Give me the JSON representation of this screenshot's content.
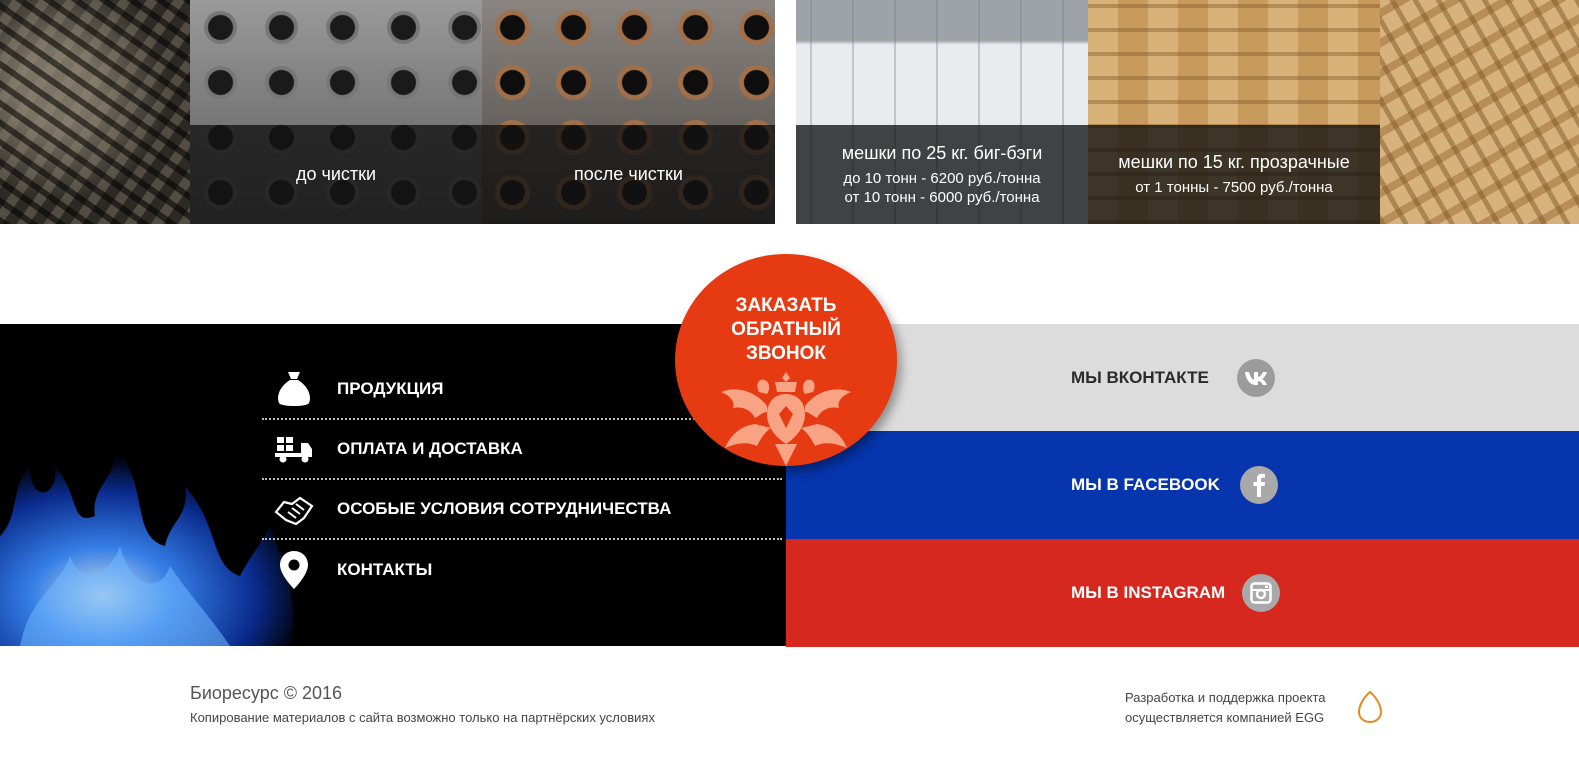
{
  "top_strip": {
    "tiles": [
      {
        "caption": ""
      },
      {
        "caption": "до чистки"
      },
      {
        "caption": "после чистки"
      },
      {
        "caption": "мешки по 25 кг. биг-бэги",
        "lines": [
          "до 10 тонн - 6200 руб./тонна",
          "от 10 тонн - 6000 руб./тонна"
        ]
      },
      {
        "caption": "мешки по 15 кг. прозрачные",
        "lines": [
          "от 1 тонны - 7500 руб./тонна"
        ]
      },
      {
        "caption": ""
      }
    ]
  },
  "callback": {
    "line1": "ЗАКАЗАТЬ",
    "line2": "ОБРАТНЫЙ",
    "line3": "ЗВОНОК",
    "color": "#e63a12"
  },
  "menu": {
    "items": [
      {
        "label": "ПРОДУКЦИЯ",
        "icon": "money-bag-icon"
      },
      {
        "label": "ОПЛАТА И ДОСТАВКА",
        "icon": "delivery-truck-icon"
      },
      {
        "label": "ОСОБЫЕ УСЛОВИЯ СОТРУДНИЧЕСТВА",
        "icon": "handshake-icon"
      },
      {
        "label": "КОНТАКТЫ",
        "icon": "map-pin-icon"
      }
    ]
  },
  "social": {
    "vk": {
      "label": "МЫ ВКОНТАКТЕ",
      "icon": "vk-icon",
      "color": "#dcdcdc"
    },
    "facebook": {
      "label": "МЫ В FACEBOOK",
      "icon": "facebook-icon",
      "color": "#0635ae"
    },
    "instagram": {
      "label": "МЫ В INSTAGRAM",
      "icon": "instagram-icon",
      "color": "#d6281f"
    }
  },
  "footer": {
    "brand": "Биоресурс © 2016",
    "copyright": "Копирование материалов с сайта возможно только на партнёрских условиях",
    "dev_line1": "Разработка и поддержка проекта",
    "dev_line2": "осуществляется компанией EGG",
    "egg_icon": "egg-logo-icon",
    "accent": "#e58a1f"
  }
}
